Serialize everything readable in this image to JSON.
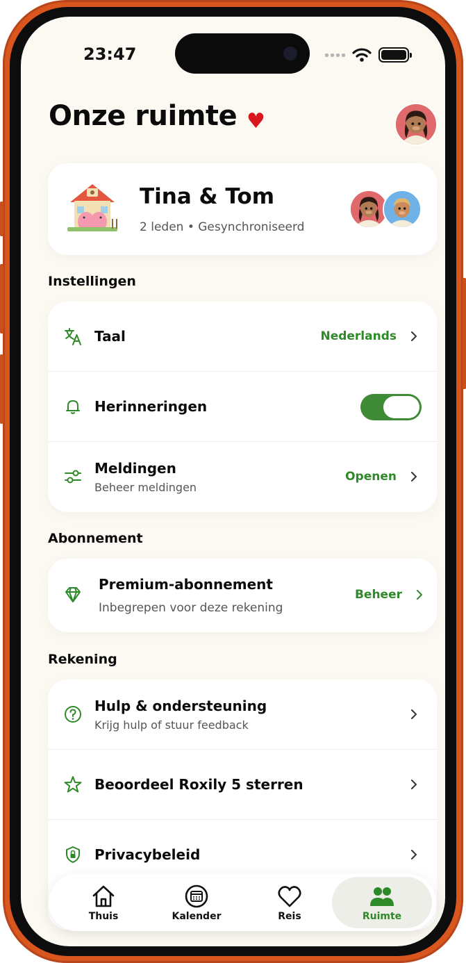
{
  "status_bar": {
    "time": "23:47"
  },
  "header": {
    "title": "Onze ruimte"
  },
  "space": {
    "name": "Tina & Tom",
    "subtitle": "2 leden • Gesynchroniseerd"
  },
  "sections": {
    "settings_label": "Instellingen",
    "subscription_label": "Abonnement",
    "account_label": "Rekening"
  },
  "settings": {
    "language": {
      "title": "Taal",
      "value": "Nederlands"
    },
    "reminders": {
      "title": "Herinneringen",
      "enabled": true
    },
    "notifications": {
      "title": "Meldingen",
      "subtitle": "Beheer meldingen",
      "value": "Openen"
    }
  },
  "subscription": {
    "title": "Premium-abonnement",
    "subtitle": "Inbegrepen voor deze rekening",
    "value": "Beheer"
  },
  "account": {
    "help": {
      "title": "Hulp & ondersteuning",
      "subtitle": "Krijg hulp of stuur feedback"
    },
    "rate": {
      "title": "Beoordeel Roxily 5 sterren"
    },
    "privacy": {
      "title": "Privacybeleid"
    }
  },
  "tabbar": {
    "tabs": [
      {
        "label": "Thuis",
        "icon": "house-icon"
      },
      {
        "label": "Kalender",
        "icon": "calendar-icon"
      },
      {
        "label": "Reis",
        "icon": "heart-icon"
      },
      {
        "label": "Ruimte",
        "icon": "people-icon",
        "active": true
      }
    ]
  },
  "colors": {
    "accent": "#2e8a28",
    "frame": "#d9571f",
    "background": "#fbf9f2",
    "heart": "#d8161b"
  }
}
